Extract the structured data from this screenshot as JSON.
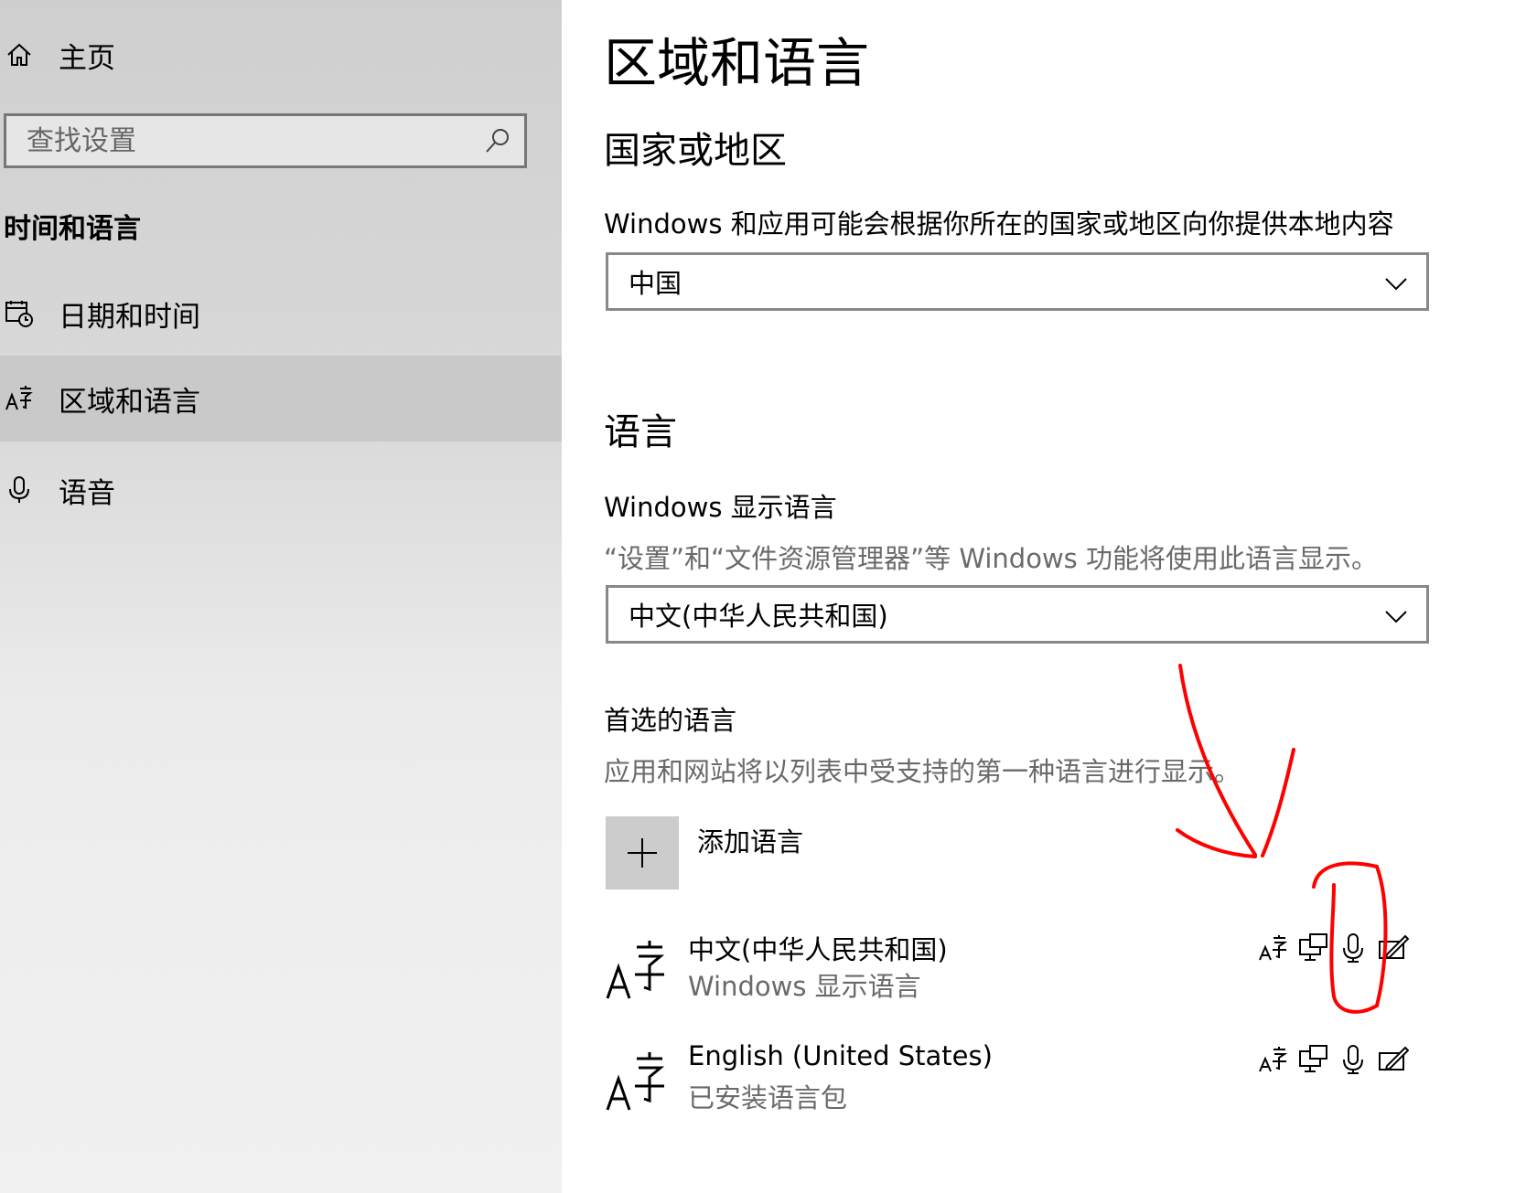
{
  "sidebar": {
    "home_label": "主页",
    "search_placeholder": "查找设置",
    "section_title": "时间和语言",
    "items": [
      {
        "label": "日期和时间",
        "icon": "calendar-clock-icon"
      },
      {
        "label": "区域和语言",
        "icon": "language-icon",
        "selected": true
      },
      {
        "label": "语音",
        "icon": "microphone-icon"
      }
    ]
  },
  "main": {
    "title": "区域和语言",
    "region": {
      "heading": "国家或地区",
      "description": "Windows 和应用可能会根据你所在的国家或地区向你提供本地内容",
      "selected": "中国"
    },
    "language": {
      "heading": "语言",
      "display_label": "Windows 显示语言",
      "display_desc": "“设置”和“文件资源管理器”等 Windows 功能将使用此语言显示。",
      "display_selected": "中文(中华人民共和国)",
      "preferred_label": "首选的语言",
      "preferred_desc": "应用和网站将以列表中受支持的第一种语言进行显示。",
      "add_label": "添加语言",
      "items": [
        {
          "name": "中文(中华人民共和国)",
          "desc": "Windows 显示语言"
        },
        {
          "name": "English (United States)",
          "desc": "已安装语言包"
        }
      ]
    }
  },
  "colors": {
    "annotation": "#ff0000",
    "selected_bg": "#c9c9c9"
  }
}
